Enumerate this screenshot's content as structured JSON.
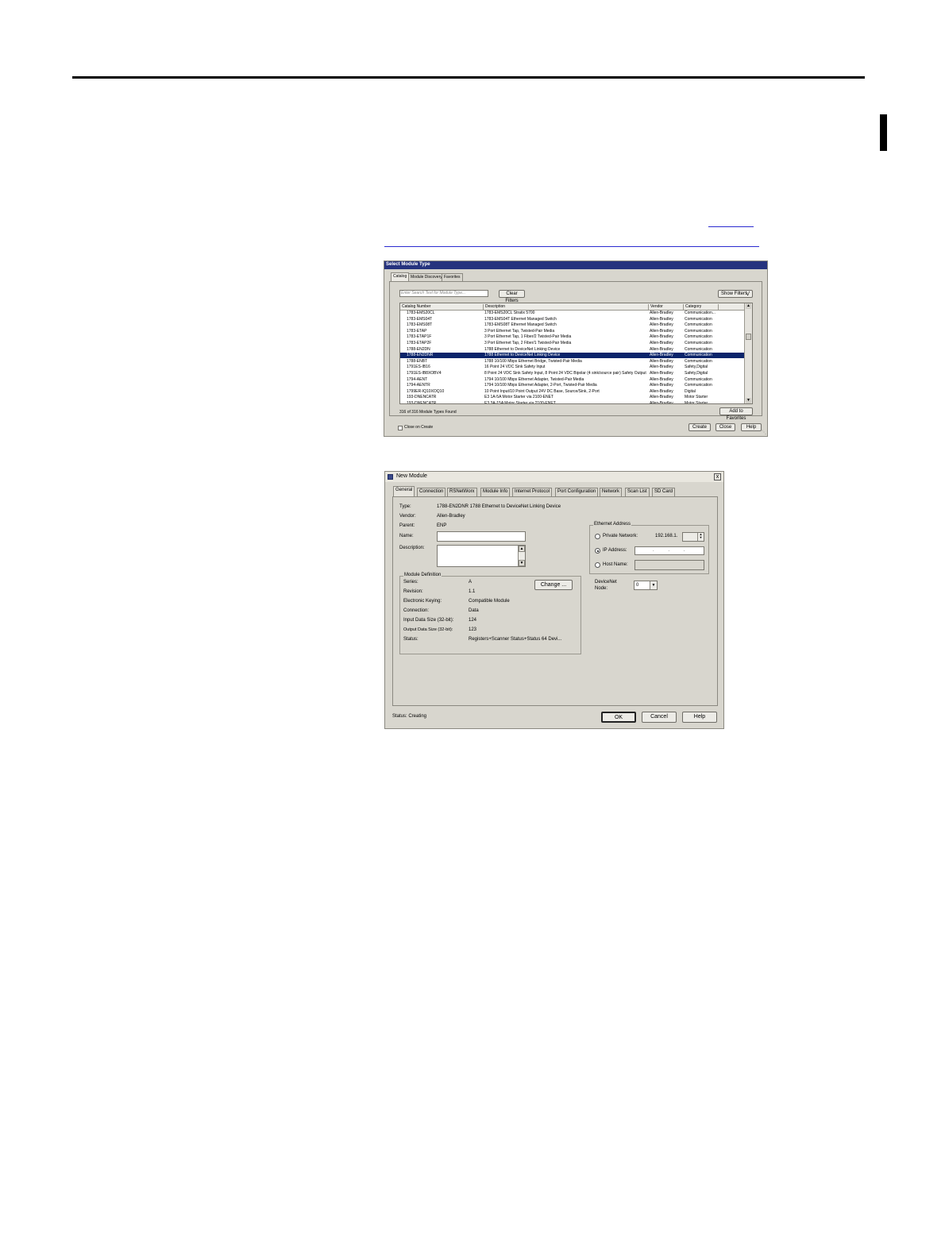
{
  "select_module_type": {
    "title": "Select Module Type",
    "tabs": [
      "Catalog",
      "Module Discovery",
      "Favorites"
    ],
    "search_placeholder": "Enter Search Text for Module Type...",
    "clear_filters_label": "Clear Filters",
    "show_filters_label": "Show Filters",
    "show_filters_icon": "double-chevron-down-icon",
    "columns": [
      "Catalog Number",
      "Description",
      "Vendor",
      "Category"
    ],
    "rows": [
      {
        "catalog": "1783-EMS20CL",
        "description": "1783-EMS20CL Stratix 5700",
        "vendor": "Allen-Bradley",
        "category": "Communication..."
      },
      {
        "catalog": "1783-EMS04T",
        "description": "1783-EMS04T Ethernet Managed Switch",
        "vendor": "Allen-Bradley",
        "category": "Communication"
      },
      {
        "catalog": "1783-EMS08T",
        "description": "1783-EMS08T Ethernet Managed Switch",
        "vendor": "Allen-Bradley",
        "category": "Communication"
      },
      {
        "catalog": "1783-ETAP",
        "description": "3 Port Ethernet Tap, Twisted-Pair Media",
        "vendor": "Allen-Bradley",
        "category": "Communication"
      },
      {
        "catalog": "1783-ETAP1F",
        "description": "3 Port Ethernet Tap, 1 Fiber/2 Twisted-Pair Media",
        "vendor": "Allen-Bradley",
        "category": "Communication"
      },
      {
        "catalog": "1783-ETAP2F",
        "description": "3 Port Ethernet Tap, 2 Fiber/1 Twisted-Pair Media",
        "vendor": "Allen-Bradley",
        "category": "Communication"
      },
      {
        "catalog": "1788-EN2DN",
        "description": "1788 Ethernet to DeviceNet Linking Device",
        "vendor": "Allen-Bradley",
        "category": "Communication"
      },
      {
        "catalog": "1788-EN2DNR",
        "description": "1788 Ethernet to DeviceNet Linking Device",
        "vendor": "Allen-Bradley",
        "category": "Communication"
      },
      {
        "catalog": "1788-ENBT",
        "description": "1788 10/100 Mbps Ethernet Bridge, Twisted-Pair Media",
        "vendor": "Allen-Bradley",
        "category": "Communication"
      },
      {
        "catalog": "1791ES-IB16",
        "description": "16 Point 24 VDC Sink Safety Input",
        "vendor": "Allen-Bradley",
        "category": "Safety,Digital"
      },
      {
        "catalog": "1791ES-IB8XOBV4",
        "description": "8 Point 24 VDC Sink Safety Input, 8 Point 24 VDC Bipolar (4 sink/source pair) Safety Output",
        "vendor": "Allen-Bradley",
        "category": "Safety,Digital"
      },
      {
        "catalog": "1794-AENT",
        "description": "1794 10/100 Mbps Ethernet Adapter, Twisted-Pair Media",
        "vendor": "Allen-Bradley",
        "category": "Communication"
      },
      {
        "catalog": "1794-AENTR",
        "description": "1794 10/100 Mbps Ethernet Adapter, 2-Port, Twisted-Pair Media",
        "vendor": "Allen-Bradley",
        "category": "Communication"
      },
      {
        "catalog": "1799ER-IQ10XOQ10",
        "description": "10 Point Input/10 Point Output 24V DC Base, Source/Sink, 2-Port",
        "vendor": "Allen-Bradley",
        "category": "Digital"
      },
      {
        "catalog": "193-DNENCATR",
        "description": "E3 1A-5A Motor Starter via 2100-ENET",
        "vendor": "Allen-Bradley",
        "category": "Motor Starter"
      },
      {
        "catalog": "193-DNENCATR",
        "description": "E3 3A-15A Motor Starter via 2100-ENET",
        "vendor": "Allen-Bradley",
        "category": "Motor Starter"
      }
    ],
    "selected_row_index": 7,
    "found_text": "316 of 316 Module Types Found",
    "add_to_favorites_label": "Add to Favorites",
    "close_on_create_label": "Close on Create",
    "create_label": "Create",
    "close_label": "Close",
    "help_label": "Help"
  },
  "new_module": {
    "title": "New Module",
    "close_glyph": "x",
    "tabs": [
      "General",
      "Connection",
      "RSNetWorx",
      "Module Info",
      "Internet Protocol",
      "Port Configuration",
      "Network",
      "Scan List",
      "SD Card"
    ],
    "type_label": "Type:",
    "type_value": "1788-EN2DNR 1788 Ethernet to DeviceNet Linking Device",
    "vendor_label": "Vendor:",
    "vendor_value": "Allen-Bradley",
    "parent_label": "Parent:",
    "parent_value": "ENP",
    "name_label": "Name:",
    "name_value": "",
    "description_label": "Description:",
    "description_value": "",
    "module_definition": {
      "title": "Module Definition",
      "series_label": "Series:",
      "series_value": "A",
      "revision_label": "Revision:",
      "revision_value": "1.1",
      "keying_label": "Electronic Keying:",
      "keying_value": "Compatible Module",
      "connection_label": "Connection:",
      "connection_value": "Data",
      "input_label": "Input Data Size (32-bit):",
      "input_value": "124",
      "output_label": "Output Data Size (32-bit):",
      "output_value": "123",
      "status_label": "Status:",
      "status_value": "Registers+Scanner Status+Status 64 Devi...",
      "change_label": "Change ..."
    },
    "ethernet_address": {
      "title": "Ethernet Address",
      "private_network_label": "Private Network:",
      "private_network_value": "192.168.1.",
      "ip_address_label": "IP Address:",
      "ip_address_value": ".   .   .",
      "host_name_label": "Host Name:",
      "selected": "IP Address"
    },
    "devicenet_label": "DeviceNet",
    "node_label": "Node:",
    "node_value": "0",
    "status_text": "Status:  Creating",
    "ok_label": "OK",
    "cancel_label": "Cancel",
    "help_label": "Help"
  }
}
